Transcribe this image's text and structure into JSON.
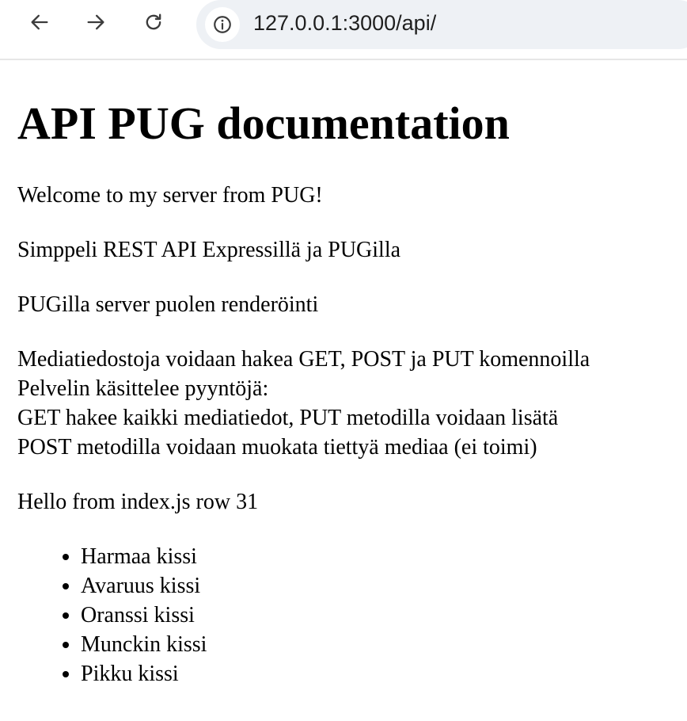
{
  "browser": {
    "url": "127.0.0.1:3000/api/",
    "icons": [
      "back-arrow-icon",
      "forward-arrow-icon",
      "reload-icon",
      "info-icon"
    ]
  },
  "page": {
    "heading": "API PUG documentation",
    "welcome": "Welcome to my server from PUG!",
    "subtitle": "Simppeli REST API Expressillä ja PUGilla",
    "render_note": "PUGilla server puolen renderöinti",
    "description_lines": [
      "Mediatiedostoja voidaan hakea GET, POST ja PUT komennoilla",
      "Pelvelin käsittelee pyyntöjä:",
      "GET hakee kaikki mediatiedot, PUT metodilla voidaan lisätä",
      "POST metodilla voidaan muokata tiettyä mediaa (ei toimi)"
    ],
    "hello": "Hello from index.js row 31",
    "cats": [
      "Harmaa kissi",
      "Avaruus kissi",
      "Oranssi kissi",
      "Munckin kissi",
      "Pikku kissi"
    ]
  }
}
